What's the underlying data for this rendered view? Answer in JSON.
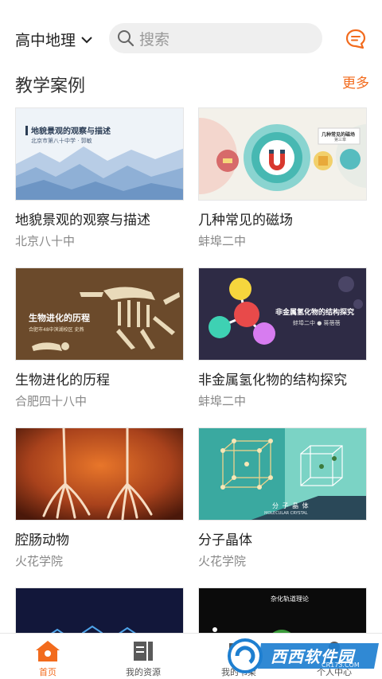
{
  "header": {
    "subject": "高中地理",
    "search_placeholder": "搜索"
  },
  "section": {
    "title": "教学案例",
    "more_label": "更多"
  },
  "cards": [
    {
      "title": "地貌景观的观察与描述",
      "school": "北京八十中",
      "thumb_title": "地貌景观的观察与描述",
      "thumb_sub": "北京市第八十中学 · 郭敏"
    },
    {
      "title": "几种常见的磁场",
      "school": "蚌埠二中",
      "thumb_title": "几种常见的磁场",
      "thumb_sub": "第三章"
    },
    {
      "title": "生物进化的历程",
      "school": "合肥四十八中",
      "thumb_title": "生物进化的历程",
      "thumb_sub": "合肥市48中滨湖校区  史燕"
    },
    {
      "title": "非金属氢化物的结构探究",
      "school": "蚌埠二中",
      "thumb_title": "非金属氢化物的结构探究",
      "thumb_sub": "蚌埠二中 ● 蒋蓓蓓"
    },
    {
      "title": "腔肠动物",
      "school": "火花学院"
    },
    {
      "title": "分子晶体",
      "school": "火花学院",
      "thumb_title": "分 子 晶 体",
      "thumb_sub": "MOLECULAR CRYSTAL"
    },
    {
      "title": "",
      "school": ""
    },
    {
      "title": "",
      "school": "",
      "thumb_title": "杂化轨道理论"
    }
  ],
  "nav": [
    {
      "label": "首页",
      "icon": "home-icon"
    },
    {
      "label": "我的资源",
      "icon": "resources-icon"
    },
    {
      "label": "我的书架",
      "icon": "bookshelf-icon"
    },
    {
      "label": "个人中心",
      "icon": "person-icon"
    }
  ],
  "watermark": {
    "text": "西西软件园",
    "sub": "CR173.COM"
  },
  "colors": {
    "accent": "#f26b1d",
    "text": "#222222",
    "muted": "#888888"
  }
}
